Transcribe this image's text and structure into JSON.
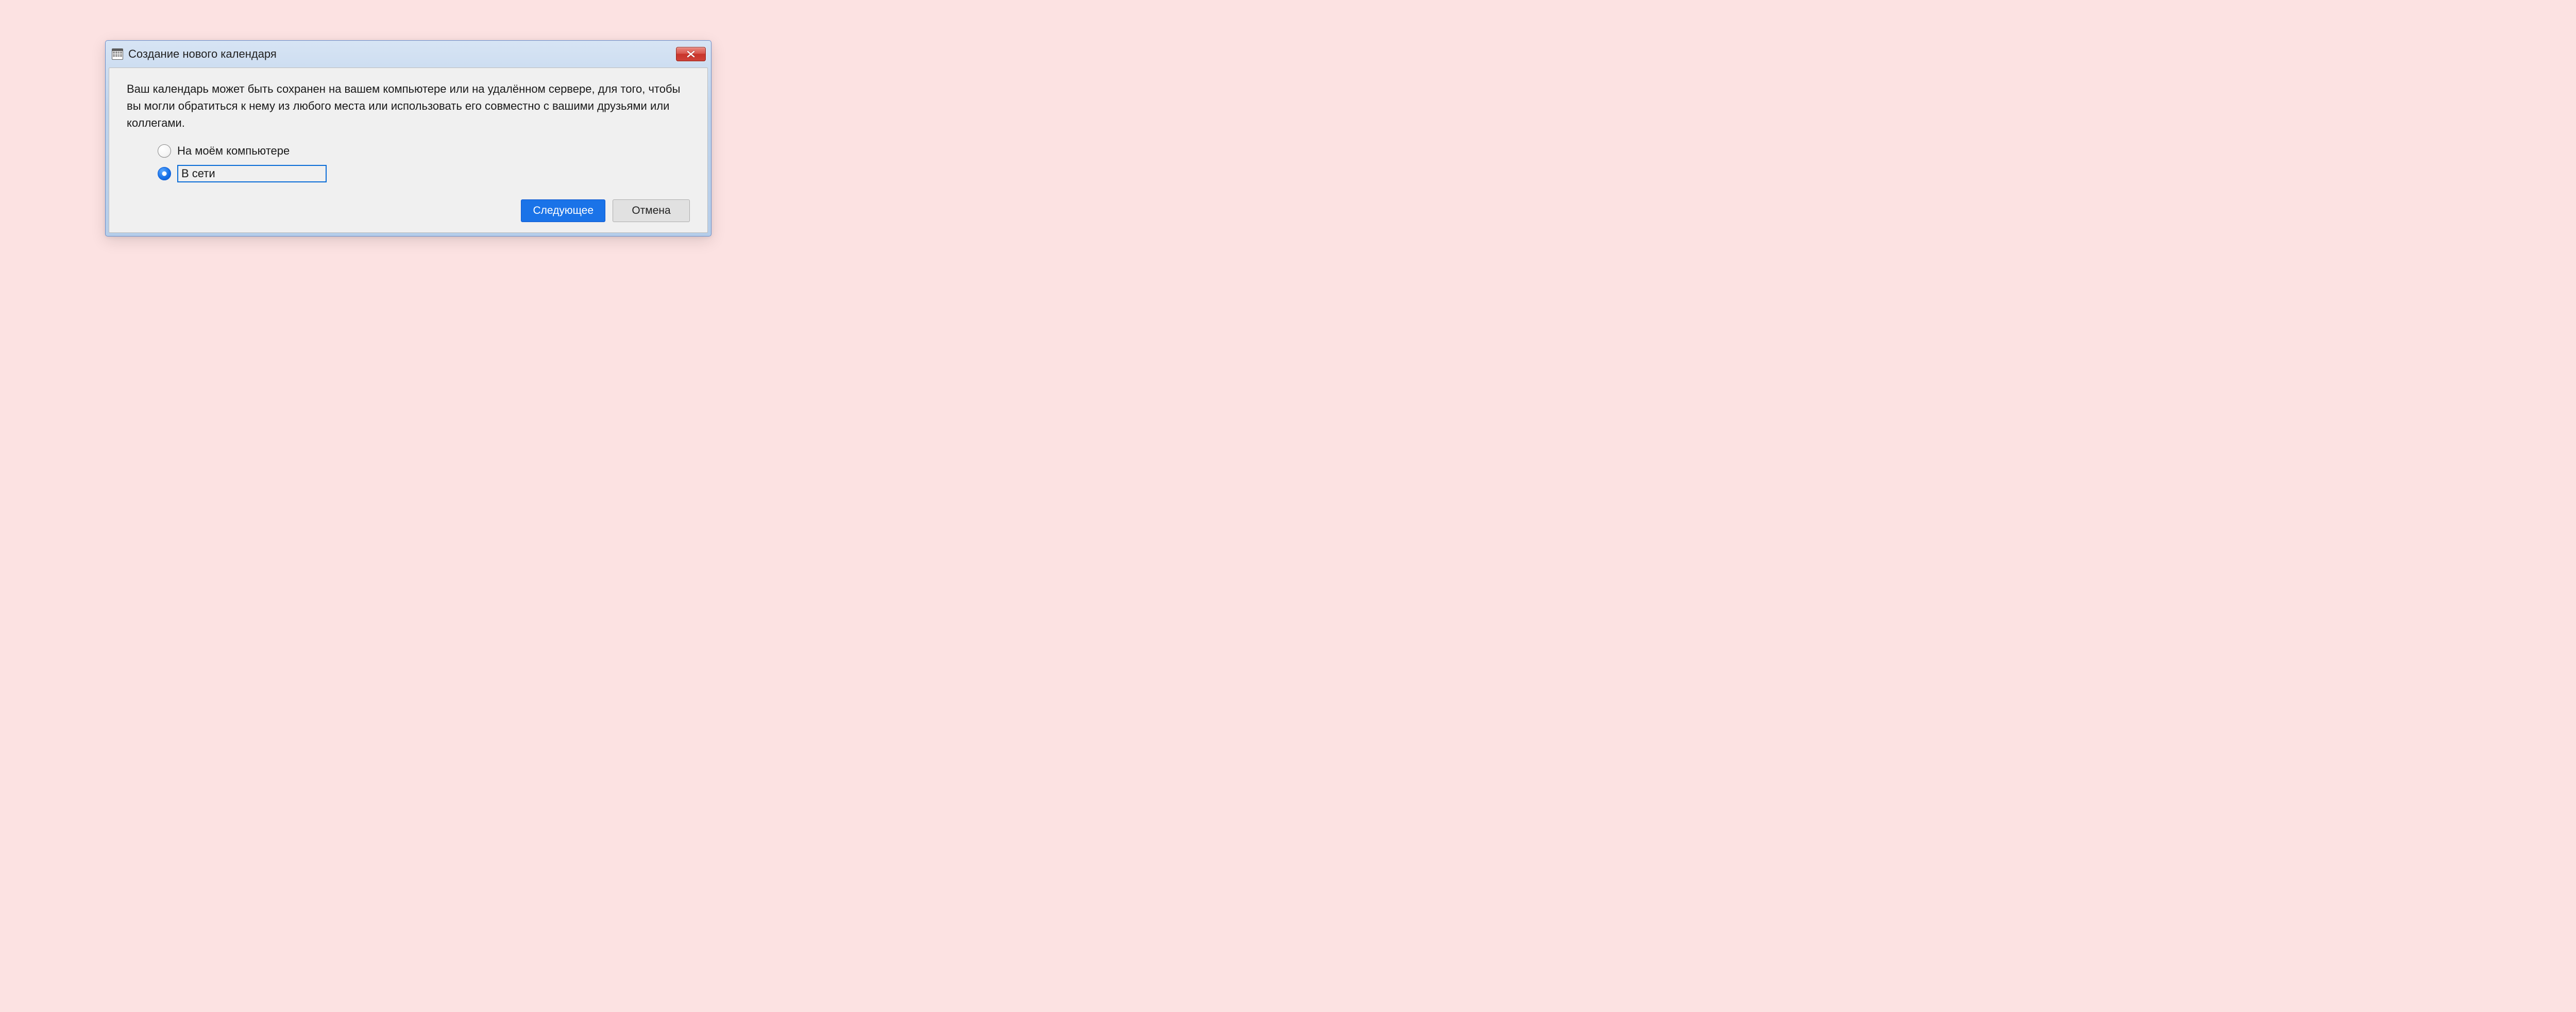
{
  "dialog": {
    "title": "Создание нового календаря",
    "intro": "Ваш календарь может быть сохранен на вашем компьютере или на удалённом сервере, для того, чтобы вы могли обратиться к нему из любого места или использовать его совместно с вашими друзьями или коллегами.",
    "options": {
      "local": {
        "label": "На моём компьютере",
        "selected": false
      },
      "network": {
        "label": "В сети",
        "selected": true
      }
    },
    "buttons": {
      "next": "Следующее",
      "cancel": "Отмена"
    }
  }
}
